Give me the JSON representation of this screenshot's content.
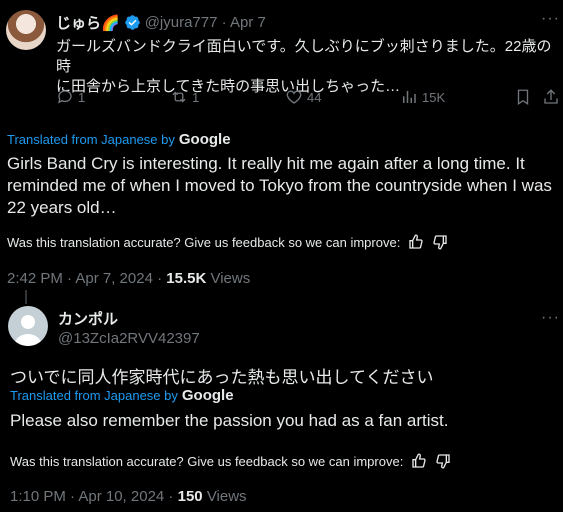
{
  "tweet1": {
    "display_name": "じゅら🌈",
    "handle_date": "@jyura777 · Apr 7",
    "text_line1": "ガールズバンドクライ面白いです。久しぶりにブッ刺さりました。22歳の時",
    "text_line2": "に田舎から上京してきた時の事思い出しちゃった…",
    "replies": "1",
    "reposts": "1",
    "likes": "44",
    "views": "15K",
    "translated_label": "Translated from Japanese by",
    "google": "Google",
    "translation_line1": "Girls Band Cry is interesting. It really hit me again after a long time. It",
    "translation_line2": "reminded me of when I moved to Tokyo from the countryside when I was",
    "translation_line3": "22 years old…",
    "feedback": "Was this translation accurate? Give us feedback so we can improve:",
    "timestamp": "2:42 PM · Apr 7, 2024 ·",
    "view_count": "15.5K",
    "views_label": "Views"
  },
  "tweet2": {
    "display_name": "カンポル",
    "handle": "@13ZcIa2RVV42397",
    "text": "ついでに同人作家時代にあった熱も思い出してください",
    "translated_label": "Translated from Japanese by",
    "google": "Google",
    "translation": "Please also remember the passion you had as a fan artist.",
    "feedback": "Was this translation accurate? Give us feedback so we can improve:",
    "timestamp": "1:10 PM · Apr 10, 2024 ·",
    "view_count": "150",
    "views_label": "Views"
  },
  "icons": {
    "verified": "verified-badge-icon",
    "reply": "reply-icon",
    "repost": "repost-icon",
    "like": "heart-icon",
    "views": "views-chart-icon",
    "bookmark": "bookmark-icon",
    "share": "share-icon",
    "more": "more-icon",
    "thumb_up": "thumbs-up-icon",
    "thumb_down": "thumbs-down-icon"
  },
  "colors": {
    "accent": "#1d9bf0",
    "muted": "#71767b",
    "text": "#e7e9ea",
    "background": "#000000"
  }
}
